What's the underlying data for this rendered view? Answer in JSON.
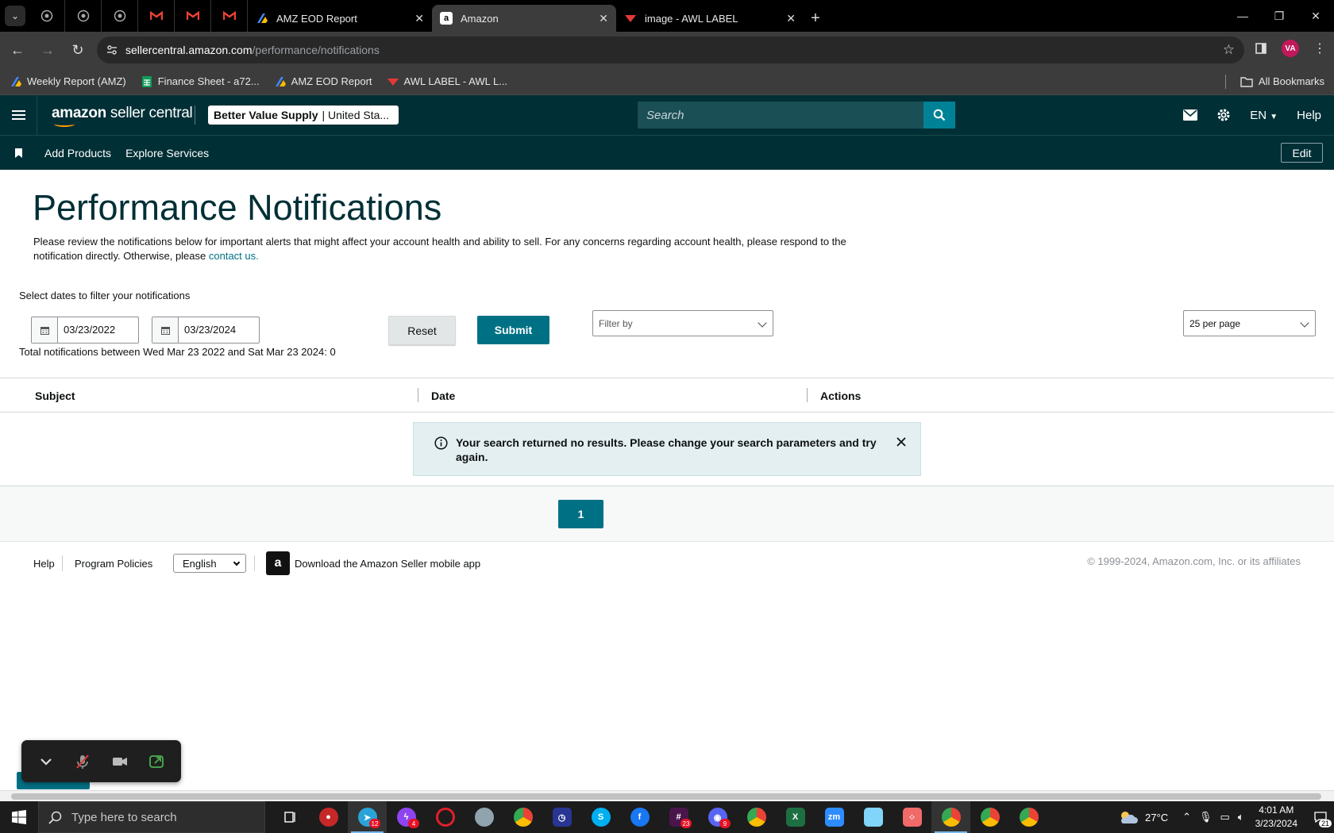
{
  "browser": {
    "tabs": [
      {
        "label": "AMZ EOD Report",
        "active": false
      },
      {
        "label": "Amazon",
        "active": true
      },
      {
        "label": "image - AWL LABEL",
        "active": false
      }
    ],
    "url_domain": "sellercentral.amazon.com",
    "url_path": "/performance/notifications",
    "profile_initials": "VA",
    "bookmarks": [
      "Weekly Report (AMZ)",
      "Finance Sheet - a72...",
      "AMZ EOD Report",
      "AWL LABEL - AWL L..."
    ],
    "all_bookmarks": "All Bookmarks"
  },
  "header": {
    "logo_bold": "amazon",
    "logo_rest": " seller central",
    "account_name": "Better Value Supply",
    "account_region": "| United Sta...",
    "search_placeholder": "Search",
    "language": "EN",
    "help": "Help"
  },
  "nav": {
    "items": [
      "Add Products",
      "Explore Services"
    ],
    "edit": "Edit"
  },
  "main": {
    "title": "Performance Notifications",
    "intro_text": "Please review the notifications below for important alerts that might affect your account health and ability to sell. For any concerns regarding account health, please respond to the notification directly. Otherwise, please ",
    "intro_link": "contact us.",
    "filter_label": "Select dates to filter your notifications",
    "start_date": "03/23/2022",
    "end_date": "03/23/2024",
    "reset": "Reset",
    "submit": "Submit",
    "filter_by": "Filter by",
    "per_page": "25 per page",
    "total": "Total notifications between Wed Mar 23 2022 and Sat Mar 23 2024: 0",
    "columns": [
      "Subject",
      "Date",
      "Actions"
    ],
    "no_results": "Your search returned no results. Please change your search parameters and try again.",
    "current_page": "1"
  },
  "footer": {
    "help": "Help",
    "policies": "Program Policies",
    "language": "English",
    "app_text": "Download the Amazon Seller mobile app",
    "copyright": "© 1999-2024, Amazon.com, Inc. or its affiliates"
  },
  "taskbar": {
    "search_placeholder": "Type here to search",
    "badges": {
      "telegram": "12",
      "messenger": "4",
      "slack": "23",
      "discord": "9"
    },
    "temperature": "27°C",
    "time": "4:01 AM",
    "date": "3/23/2024",
    "notifications": "21"
  },
  "colors": {
    "header_bg": "#002f36",
    "primary_button": "#007185",
    "alert_bg": "#e3eff1",
    "link": "#007185"
  }
}
